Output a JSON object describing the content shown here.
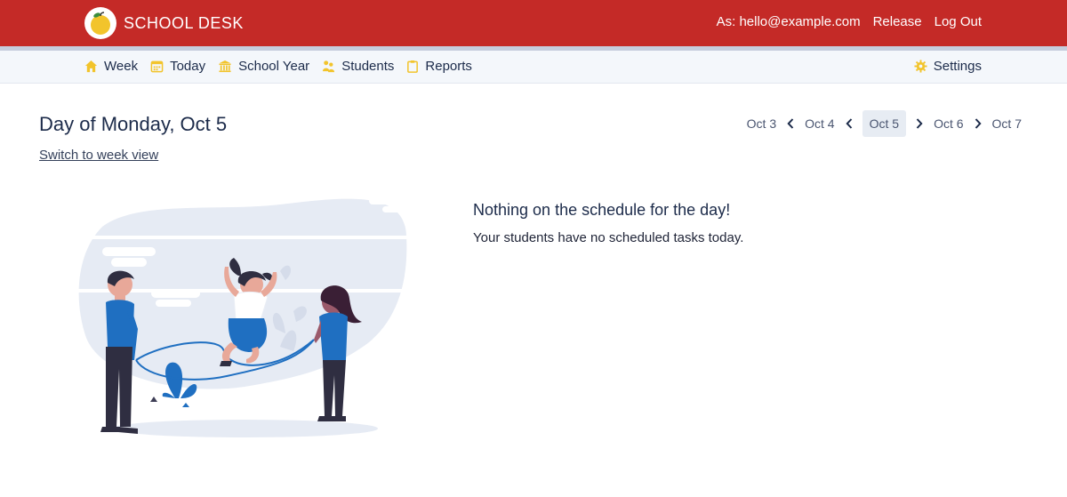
{
  "header": {
    "brand": "SCHOOL DESK",
    "user": "As: hello@example.com",
    "release": "Release",
    "logout": "Log Out"
  },
  "nav": {
    "items": [
      {
        "label": "Week",
        "icon": "home-icon"
      },
      {
        "label": "Today",
        "icon": "calendar-icon"
      },
      {
        "label": "School Year",
        "icon": "school-icon"
      },
      {
        "label": "Students",
        "icon": "students-icon"
      },
      {
        "label": "Reports",
        "icon": "clipboard-icon"
      }
    ],
    "settings": "Settings"
  },
  "main": {
    "title": "Day of Monday, Oct 5",
    "switch_link": "Switch to week view",
    "days": [
      "Oct 3",
      "Oct 4",
      "Oct 5",
      "Oct 6",
      "Oct 7"
    ],
    "active_day": "Oct 5",
    "empty_title": "Nothing on the schedule for the day!",
    "empty_subtitle": "Your students have no scheduled tasks today."
  },
  "colors": {
    "header": "#c42a27",
    "nav_bg": "#f4f7fb",
    "icon_yellow": "#f2c42c",
    "accent_blue": "#1f6fc1"
  }
}
